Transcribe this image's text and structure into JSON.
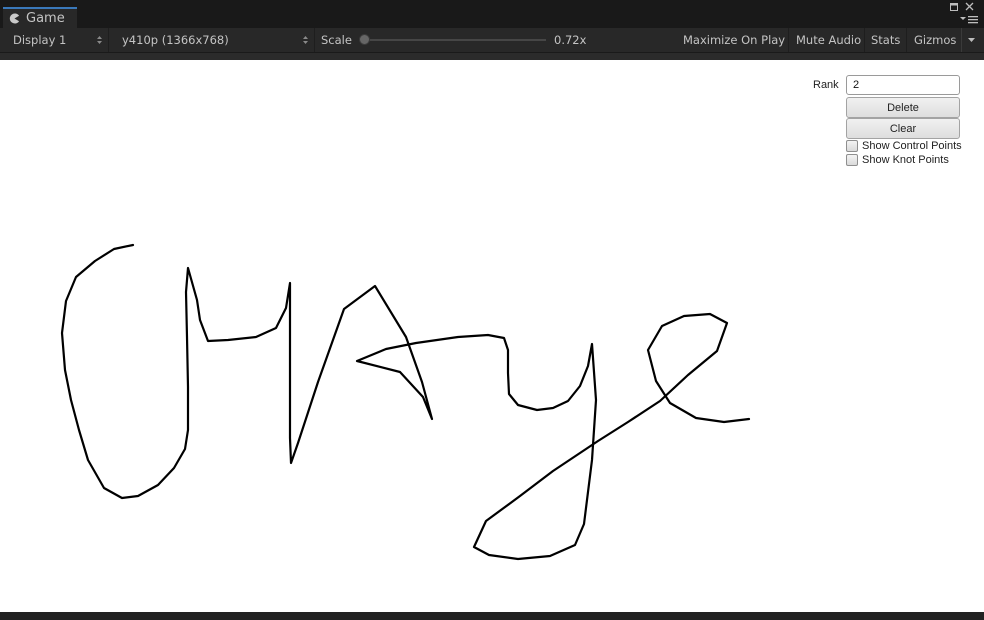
{
  "tab": {
    "title": "Game",
    "icon": "pacman-icon"
  },
  "window_controls": {
    "maximize_icon": "maximize-icon",
    "close_icon": "close-icon",
    "menu_icon": "tab-menu-icon"
  },
  "toolbar": {
    "display": "Display 1",
    "resolution": "y410p (1366x768)",
    "scale_label": "Scale",
    "scale_value": "0.72x",
    "scale_level": 0.0,
    "maximize_on_play": "Maximize On Play",
    "mute_audio": "Mute Audio",
    "stats": "Stats",
    "gizmos": "Gizmos"
  },
  "panel": {
    "rank_label": "Rank",
    "rank_value": "2",
    "delete_label": "Delete",
    "clear_label": "Clear",
    "show_control_points_label": "Show Control Points",
    "show_control_points_checked": false,
    "show_knot_points_label": "Show Knot Points",
    "show_knot_points_checked": false
  },
  "colors": {
    "editor_bg": "#282828",
    "tab_accent": "#3a79bb",
    "canvas_bg": "#ffffff",
    "stroke": "#000000"
  }
}
